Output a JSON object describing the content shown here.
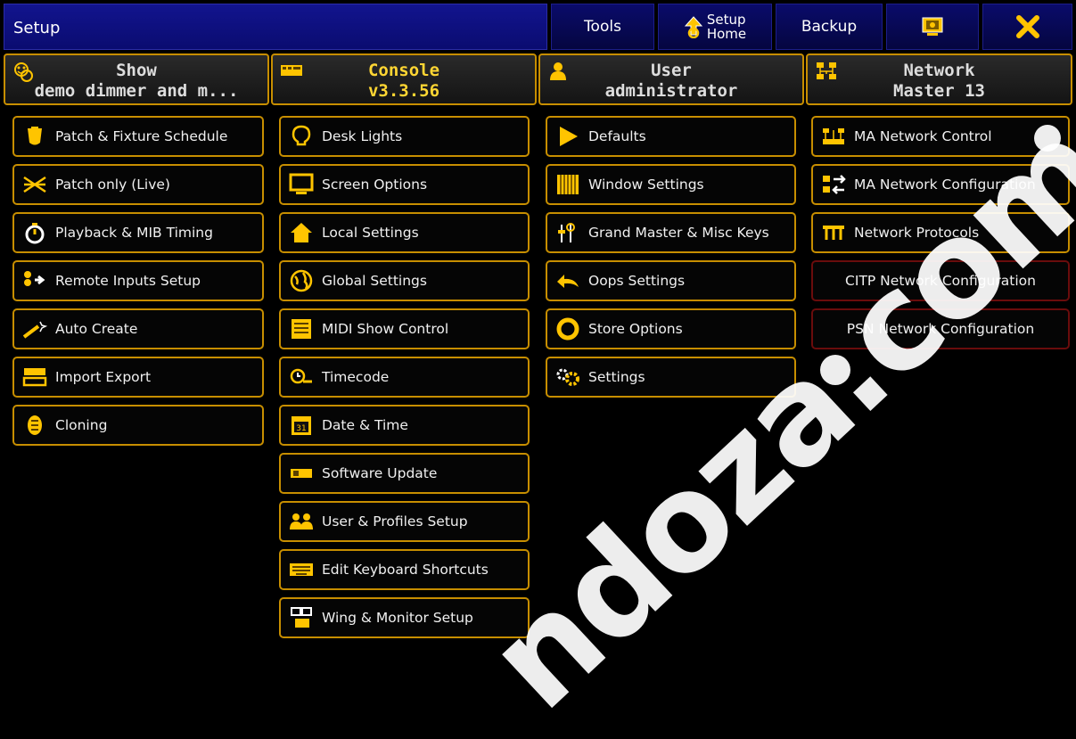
{
  "window": {
    "title": "Setup"
  },
  "toolbar": {
    "tools_label": "Tools",
    "home_label_1": "Setup",
    "home_label_2": "Home",
    "backup_label": "Backup"
  },
  "headers": {
    "show": {
      "line1": "Show",
      "line2": "demo dimmer and m..."
    },
    "console": {
      "line1": "Console",
      "line2": "v3.3.56"
    },
    "user": {
      "line1": "User",
      "line2": "administrator"
    },
    "network": {
      "line1": "Network",
      "line2": "Master 13"
    }
  },
  "show_items": [
    "Patch & Fixture Schedule",
    "Patch only (Live)",
    "Playback & MIB Timing",
    "Remote Inputs Setup",
    "Auto Create",
    "Import Export",
    "Cloning"
  ],
  "console_items": [
    "Desk Lights",
    "Screen Options",
    "Local Settings",
    "Global Settings",
    "MIDI Show Control",
    "Timecode",
    "Date & Time",
    "Software Update",
    "User & Profiles Setup",
    "Edit Keyboard Shortcuts",
    "Wing & Monitor Setup"
  ],
  "user_items": [
    "Defaults",
    "Window Settings",
    "Grand Master & Misc Keys",
    "Oops Settings",
    "Store Options",
    "Settings"
  ],
  "network_items": [
    "MA Network Control",
    "MA Network Configuration",
    "Network Protocols",
    "CITP Network Configuration",
    "PSN Network Configuration"
  ],
  "watermark": "ndoza.com.m",
  "colors": {
    "accent": "#c78e00",
    "title_bg": "#12148e",
    "console_header": "#ffd633",
    "disabled_border": "#6a0c0c"
  }
}
